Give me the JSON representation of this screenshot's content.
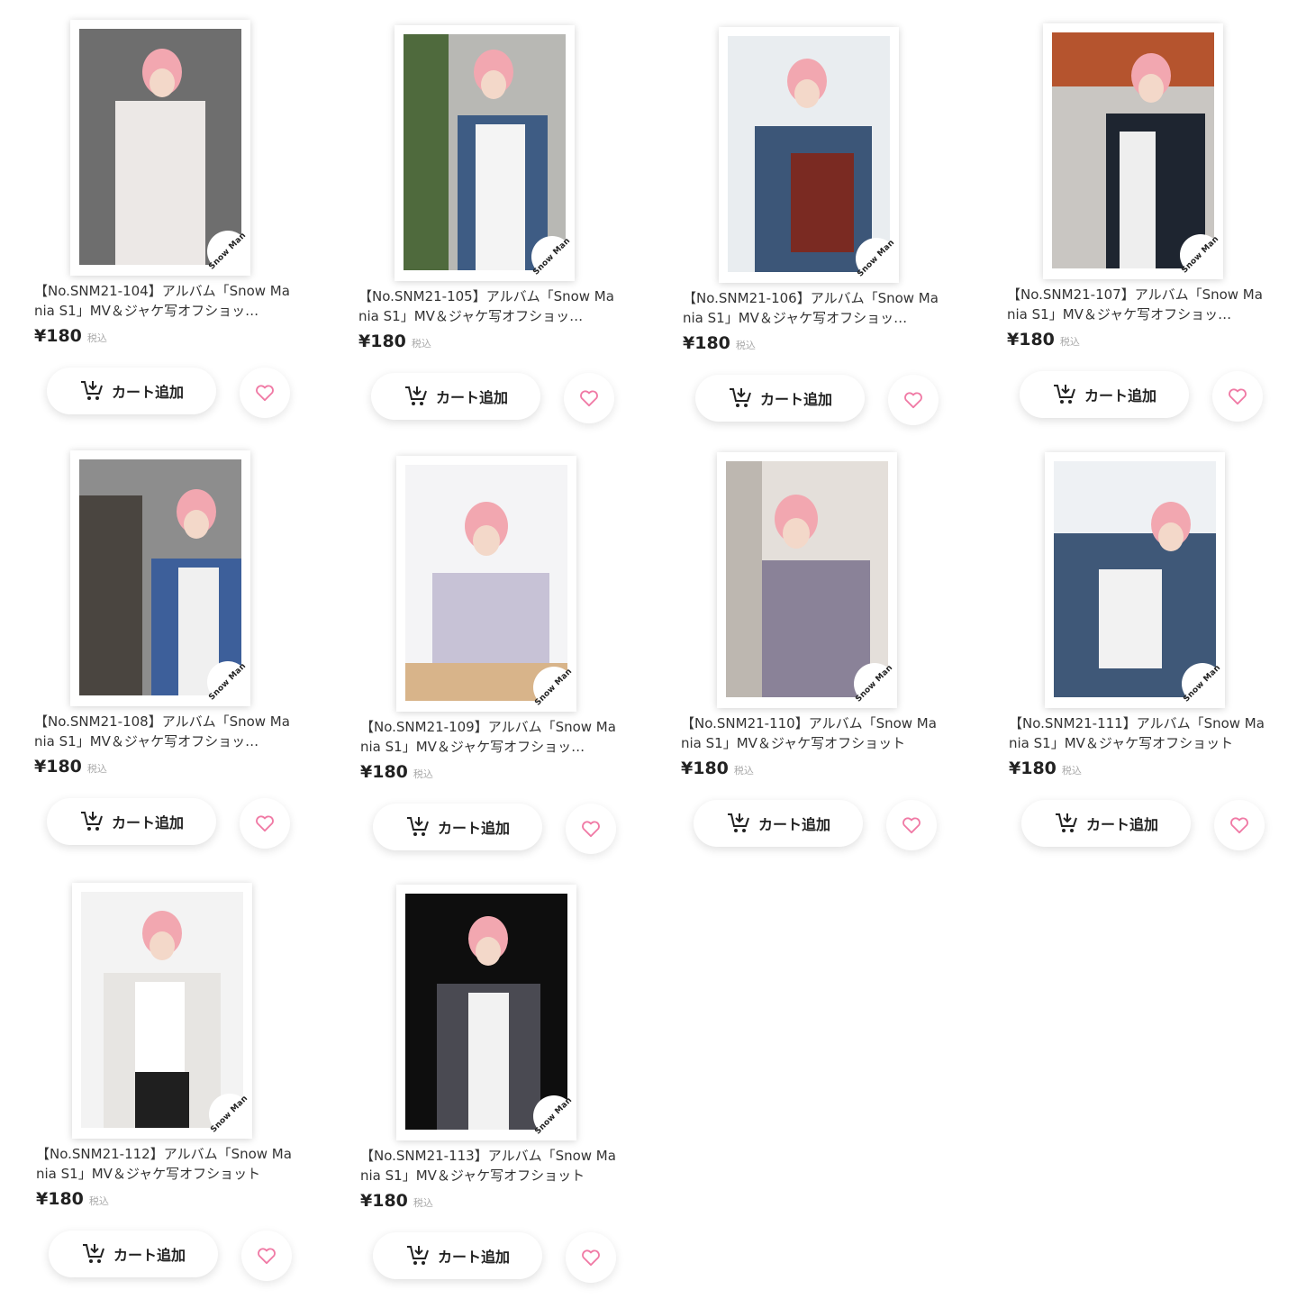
{
  "brand_logo_text": "Snow Man",
  "colors": {
    "heart": "#f07aa5",
    "hair": "#f2a7b0"
  },
  "icons": {
    "cart": "cart-add-icon",
    "favorite": "heart-outline-icon"
  },
  "products": [
    {
      "title": "【No.SNM21-104】アルバム「Snow Mania S1」MV＆ジャケ写オフショッ…",
      "price": "¥180",
      "tax": "税込",
      "cart_label": "カート追加"
    },
    {
      "title": "【No.SNM21-105】アルバム「Snow Mania S1」MV＆ジャケ写オフショッ…",
      "price": "¥180",
      "tax": "税込",
      "cart_label": "カート追加"
    },
    {
      "title": "【No.SNM21-106】アルバム「Snow Mania S1」MV＆ジャケ写オフショッ…",
      "price": "¥180",
      "tax": "税込",
      "cart_label": "カート追加"
    },
    {
      "title": "【No.SNM21-107】アルバム「Snow Mania S1」MV＆ジャケ写オフショッ…",
      "price": "¥180",
      "tax": "税込",
      "cart_label": "カート追加"
    },
    {
      "title": "【No.SNM21-108】アルバム「Snow Mania S1」MV＆ジャケ写オフショッ…",
      "price": "¥180",
      "tax": "税込",
      "cart_label": "カート追加"
    },
    {
      "title": "【No.SNM21-109】アルバム「Snow Mania S1」MV＆ジャケ写オフショッ…",
      "price": "¥180",
      "tax": "税込",
      "cart_label": "カート追加"
    },
    {
      "title": "【No.SNM21-110】アルバム「Snow Mania S1」MV＆ジャケ写オフショット",
      "price": "¥180",
      "tax": "税込",
      "cart_label": "カート追加"
    },
    {
      "title": "【No.SNM21-111】アルバム「Snow Mania S1」MV＆ジャケ写オフショット",
      "price": "¥180",
      "tax": "税込",
      "cart_label": "カート追加"
    },
    {
      "title": "【No.SNM21-112】アルバム「Snow Mania S1」MV＆ジャケ写オフショット",
      "price": "¥180",
      "tax": "税込",
      "cart_label": "カート追加"
    },
    {
      "title": "【No.SNM21-113】アルバム「Snow Mania S1」MV＆ジャケ写オフショット",
      "price": "¥180",
      "tax": "税込",
      "cart_label": "カート追加"
    }
  ]
}
